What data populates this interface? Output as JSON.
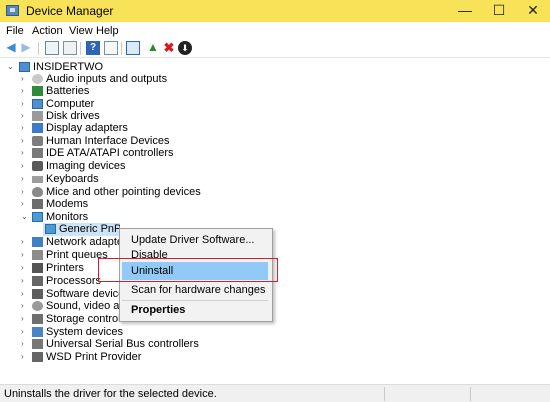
{
  "window": {
    "title": "Device Manager",
    "min_glyph": "—",
    "max_glyph": "☐",
    "close_glyph": "✕"
  },
  "menu": {
    "file": "File",
    "action": "Action",
    "view": "View",
    "help": "Help"
  },
  "toolbar": {
    "back_glyph": "◀",
    "forward_glyph": "▶",
    "help_glyph": "?",
    "update_glyph": "▲",
    "remove_glyph": "✖",
    "download_glyph": "⬇"
  },
  "tree": {
    "root": "INSIDERTWO",
    "expanded_glyph": "⌄",
    "collapsed_glyph": "›",
    "items": {
      "audio": "Audio inputs and outputs",
      "batteries": "Batteries",
      "computer": "Computer",
      "disk": "Disk drives",
      "display": "Display adapters",
      "hid": "Human Interface Devices",
      "ide": "IDE ATA/ATAPI controllers",
      "imaging": "Imaging devices",
      "keyboards": "Keyboards",
      "mice": "Mice and other pointing devices",
      "modems": "Modems",
      "monitors": "Monitors",
      "generic_pnp": "Generic PnP Monitor",
      "network": "Network adapters",
      "print_queues": "Print queues",
      "printers": "Printers",
      "processors": "Processors",
      "software": "Software devices",
      "sound": "Sound, video and game controllers",
      "storage": "Storage controllers",
      "system": "System devices",
      "usb": "Universal Serial Bus controllers",
      "wsd": "WSD Print Provider"
    }
  },
  "context_menu": {
    "update": "Update Driver Software...",
    "disable": "Disable",
    "uninstall": "Uninstall",
    "scan": "Scan for hardware changes",
    "properties": "Properties"
  },
  "status": {
    "text": "Uninstalls the driver for the selected device."
  },
  "colors": {
    "title_bar": "#f8e257",
    "menu_highlight": "#91c9f7",
    "callout_red": "#d21f2b"
  }
}
